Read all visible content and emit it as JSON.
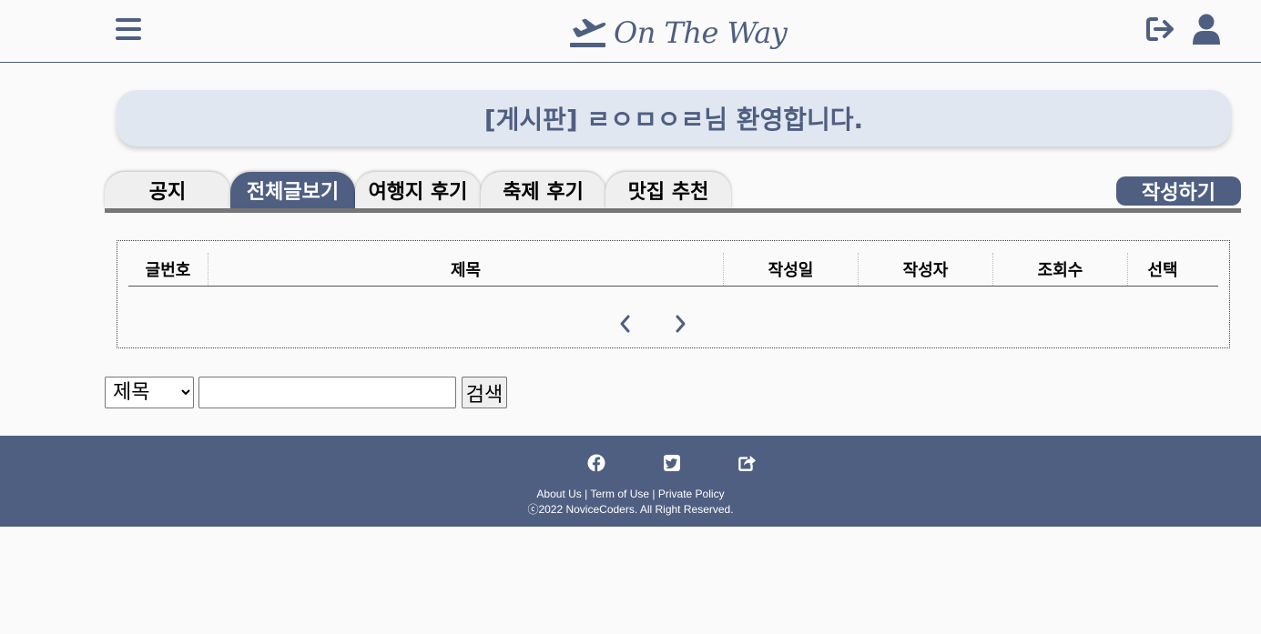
{
  "header": {
    "brand": "On The Way",
    "icons": [
      "hamburger-menu-icon",
      "airplane-departure-icon",
      "logout-icon",
      "user-icon"
    ]
  },
  "welcome": {
    "text": "[게시판] ㄹㅇㅁㅇㄹ님 환영합니다."
  },
  "tabs": [
    {
      "label": "공지",
      "active": false
    },
    {
      "label": "전체글보기",
      "active": true
    },
    {
      "label": "여행지 후기",
      "active": false
    },
    {
      "label": "축제 후기",
      "active": false
    },
    {
      "label": "맛집 추천",
      "active": false
    }
  ],
  "write_button": "작성하기",
  "table": {
    "columns": [
      "글번호",
      "제목",
      "작성일",
      "작성자",
      "조회수",
      "선택"
    ],
    "rows": []
  },
  "pagination": {
    "prev_icon": "chevron-left-icon",
    "next_icon": "chevron-right-icon"
  },
  "search": {
    "selected_option": "제목",
    "query": "",
    "button_label": "검색"
  },
  "footer": {
    "social_icons": [
      "facebook-icon",
      "twitter-icon",
      "share-icon"
    ],
    "links": [
      "About Us",
      "Term of Use",
      "Private Policy"
    ],
    "separator": "|",
    "copyright": "ⓒ2022 NoviceCoders. All Right Reserved."
  },
  "colors": {
    "primary": "#4f5f82",
    "welcome_bg": "#e1e7f0",
    "tab_bg": "#efefef",
    "rule": "#767676",
    "page_bg": "#fafafa"
  }
}
